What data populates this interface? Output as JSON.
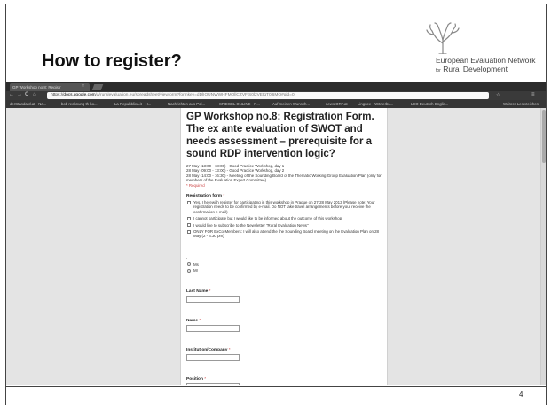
{
  "slide": {
    "title": "How to register?",
    "page_number": "4",
    "logo": {
      "line1": "European Evaluation Network",
      "line2_small": "for",
      "line2_main": "Rural Development"
    }
  },
  "browser": {
    "tab_title": "GP Workshop no.8: Registr",
    "tab_close": "×",
    "nav": {
      "back": "←",
      "forward": "→",
      "reload": "C",
      "home": "⌂",
      "lock": "🔒"
    },
    "url": {
      "scheme": "https://",
      "host": "docs.google.com",
      "rest": "/a/ruralevaluation.eu/spreadsheet/viewform?formkey=dDlIOUNWWHFMOllCZVFiS0l2VEtqT0l6MQ#gid=0"
    },
    "toolbar_icons": {
      "star": "☆",
      "menu": "≡"
    },
    "bookmarks": [
      "derStandard.at - Na...",
      "bob rechnung th bo...",
      "La Repubblica.it - H...",
      "Nachrichten aus Pol...",
      "SPIEGEL ONLINE - N...",
      "Auf meinen Wunsch...",
      "news ORF.at",
      "Linguee - Wörterbu...",
      "LEO Deutsch-Englis...",
      "Weitere Lesezeichen"
    ]
  },
  "form": {
    "title": "GP Workshop no.8: Registration Form. The ex ante evaluation of SWOT and needs assessment – prerequisite for a sound RDP intervention logic?",
    "description": [
      "27 May (13:00 - 18:00) - Good Practice Workshop, day 1",
      "28 May (09:00 - 13:00) - Good Practice Workshop, day 2",
      "28 May (14:00 - 16:30) - Meeting of the Sounding Board of the Thematic Working Group Evaluation Plan (only for members of the Evaluation Expert Committee)"
    ],
    "required_note": "* Required",
    "registration_label": "Registration form",
    "star": "*",
    "options": [
      "Yes, I herewith register for participating in this workshop in Prague on 27-28 May 2013 (Please note: Your registration needs to be confirmed by e-mail. Do NOT take travel arrangements before your receive the confirmation e-mail)",
      "I cannot participate but I would like to be informed about the outcome of this workshop",
      "I would like to subscribe to the Newsletter \"Rural Evaluation News\"",
      "ONLY FOR ExCo-Members: I will also attend the the Sounding Board meeting on the Evaluation Plan on 28 May (2 - 4.30 pm)"
    ],
    "dot": ".",
    "radio_options": [
      "Ms",
      "Mr"
    ],
    "fields": [
      {
        "label": "Last Name",
        "value": ""
      },
      {
        "label": "Name",
        "value": ""
      },
      {
        "label": "Institution/Company",
        "value": ""
      },
      {
        "label": "Position",
        "value": ""
      }
    ]
  }
}
